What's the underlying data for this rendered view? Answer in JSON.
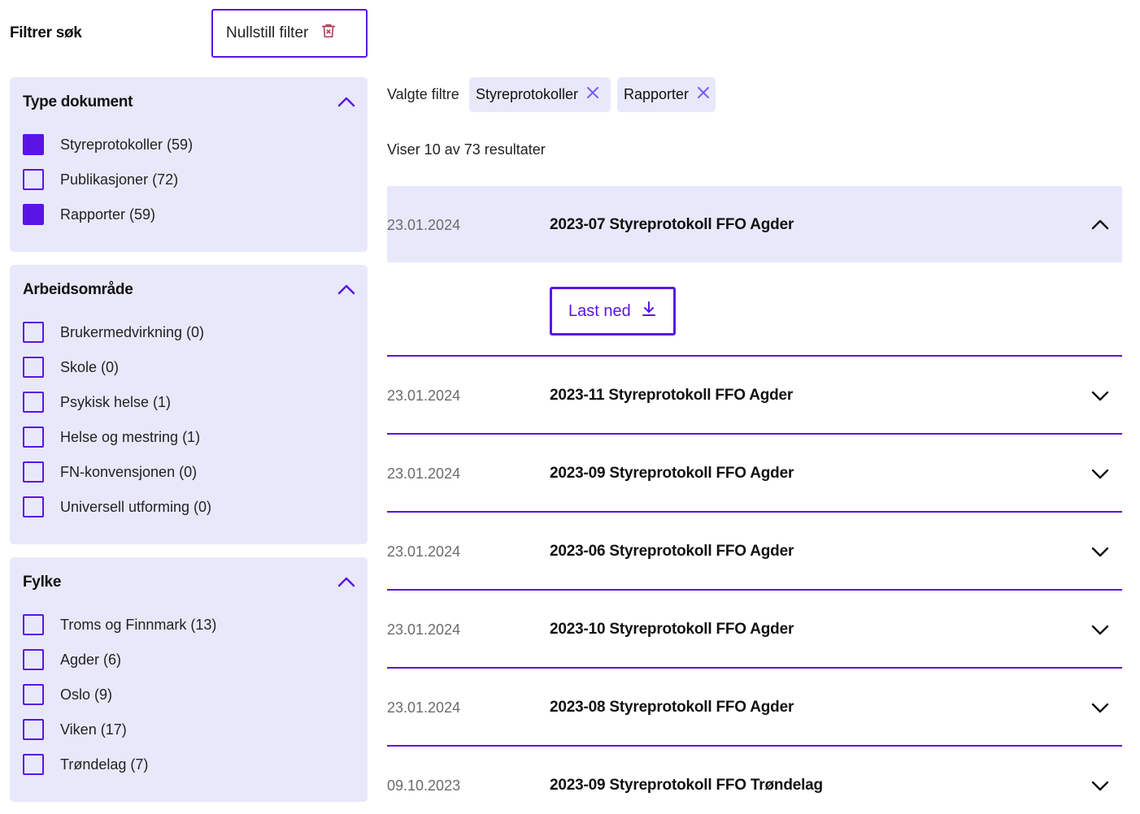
{
  "filter": {
    "heading": "Filtrer søk",
    "reset_label": "Nullstill filter"
  },
  "panels": [
    {
      "title": "Type dokument",
      "items": [
        {
          "label": "Styreprotokoller (59)",
          "checked": true
        },
        {
          "label": "Publikasjoner (72)",
          "checked": false
        },
        {
          "label": "Rapporter (59)",
          "checked": true
        }
      ]
    },
    {
      "title": "Arbeidsområde",
      "items": [
        {
          "label": "Brukermedvirkning (0)",
          "checked": false
        },
        {
          "label": "Skole (0)",
          "checked": false
        },
        {
          "label": "Psykisk helse (1)",
          "checked": false
        },
        {
          "label": "Helse og mestring (1)",
          "checked": false
        },
        {
          "label": "FN-konvensjonen (0)",
          "checked": false
        },
        {
          "label": "Universell utforming (0)",
          "checked": false
        }
      ]
    },
    {
      "title": "Fylke",
      "items": [
        {
          "label": "Troms og Finnmark (13)",
          "checked": false
        },
        {
          "label": "Agder (6)",
          "checked": false
        },
        {
          "label": "Oslo (9)",
          "checked": false
        },
        {
          "label": "Viken (17)",
          "checked": false
        },
        {
          "label": "Trøndelag (7)",
          "checked": false
        }
      ]
    }
  ],
  "selected": {
    "label": "Valgte filtre",
    "chips": [
      "Styreprotokoller",
      "Rapporter"
    ]
  },
  "results": {
    "count_text": "Viser 10 av 73 resultater",
    "download_label": "Last ned",
    "items": [
      {
        "date": "23.01.2024",
        "title": "2023-07 Styreprotokoll FFO Agder",
        "expanded": true
      },
      {
        "date": "23.01.2024",
        "title": "2023-11 Styreprotokoll FFO Agder",
        "expanded": false
      },
      {
        "date": "23.01.2024",
        "title": "2023-09 Styreprotokoll FFO Agder",
        "expanded": false
      },
      {
        "date": "23.01.2024",
        "title": "2023-06 Styreprotokoll FFO Agder",
        "expanded": false
      },
      {
        "date": "23.01.2024",
        "title": "2023-10 Styreprotokoll FFO Agder",
        "expanded": false
      },
      {
        "date": "23.01.2024",
        "title": "2023-08 Styreprotokoll FFO Agder",
        "expanded": false
      },
      {
        "date": "09.10.2023",
        "title": "2023-09 Styreprotokoll FFO Trøndelag",
        "expanded": false
      }
    ]
  },
  "icons": {
    "reset": "trash-icon",
    "chip_remove": "close-icon",
    "panel_toggle": "chevron-up-icon",
    "accordion_open": "chevron-up-icon",
    "accordion_closed": "chevron-down-icon",
    "download": "download-icon"
  },
  "colors": {
    "accent": "#5a14e6",
    "panel_bg": "#e8e8fb",
    "trash_icon": "#b0415a",
    "chip_x": "#7b5cf0"
  }
}
